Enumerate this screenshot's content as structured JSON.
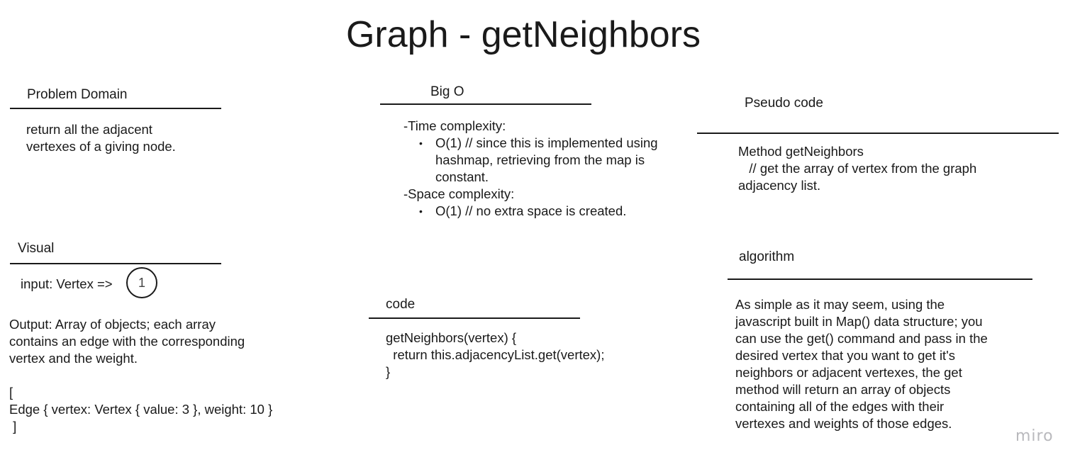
{
  "title": "Graph - getNeighbors",
  "problem_domain": {
    "heading": "Problem Domain",
    "text": "return all the adjacent\nvertexes of a giving node."
  },
  "big_o": {
    "heading": "Big O",
    "time_label": "-Time complexity:",
    "time_items": [
      "O(1) // since this is implemented using hashmap, retrieving from the map is constant."
    ],
    "space_label": "-Space complexity:",
    "space_items": [
      "O(1) // no extra space is created."
    ]
  },
  "pseudo_code": {
    "heading": "Pseudo code",
    "text": "Method getNeighbors\n   // get the array of vertex from the graph\nadjacency list."
  },
  "visual": {
    "heading": "Visual",
    "input_label": "input: Vertex =>",
    "node_value": "1",
    "output_text": "Output: Array of objects; each array\ncontains an edge with the corresponding\nvertex and the weight.",
    "array_open": "[",
    "array_item": "Edge { vertex: Vertex { value: 3 }, weight: 10 }",
    "array_close": " ]"
  },
  "code": {
    "heading": "code",
    "text": "getNeighbors(vertex) {\n  return this.adjacencyList.get(vertex);\n}"
  },
  "algorithm": {
    "heading": "algorithm",
    "text": "As simple as it may seem, using the\njavascript built in Map() data structure; you\ncan use the get() command and pass in the\ndesired vertex that you want to get it's\nneighbors or adjacent vertexes, the get\nmethod will return an array of objects\ncontaining all of the edges with their\nvertexes and weights of those edges."
  },
  "watermark": "miro",
  "colors": {
    "text": "#1a1a1a",
    "watermark": "#b9b9bd",
    "background": "#ffffff"
  }
}
